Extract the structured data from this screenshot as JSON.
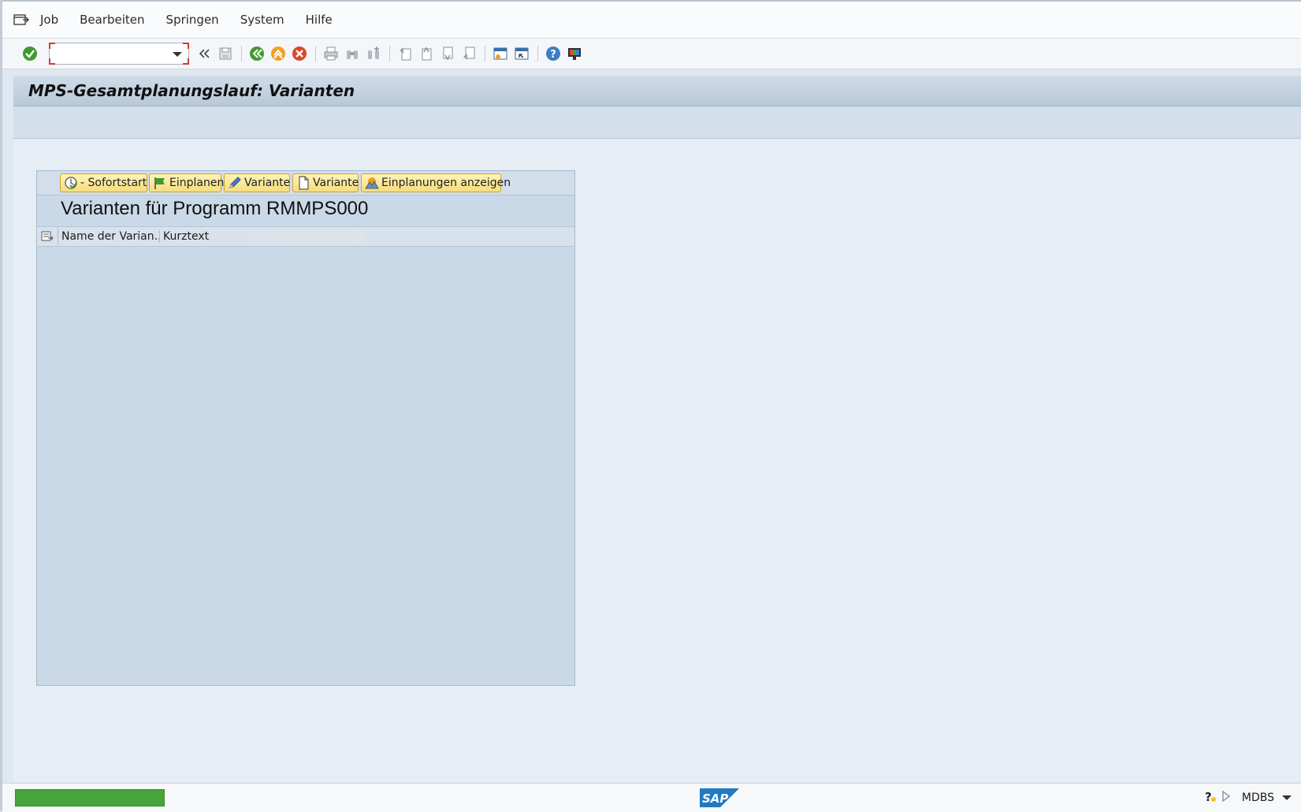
{
  "menubar": {
    "items": [
      "Job",
      "Bearbeiten",
      "Springen",
      "System",
      "Hilfe"
    ]
  },
  "toolbar": {
    "command_value": ""
  },
  "title": "MPS-Gesamtplanungslauf: Varianten",
  "panel": {
    "buttons": [
      {
        "label": "- Sofortstart",
        "icon": "execute-clock-icon"
      },
      {
        "label": "Einplanen",
        "icon": "flag-icon"
      },
      {
        "label": "Variante",
        "icon": "pencil-icon"
      },
      {
        "label": "Variante",
        "icon": "document-icon"
      },
      {
        "label": "Einplanungen anzeigen",
        "icon": "mountain-icon"
      }
    ],
    "title": "Varianten für Programm RMMPS000",
    "columns": [
      "Name der Varian...",
      "Kurztext"
    ]
  },
  "statusbar": {
    "progress": 1.0,
    "system": "MDBS",
    "logo": "SAP"
  },
  "colors": {
    "progress": "#48a43a",
    "button_bg": "#f6dd7d",
    "panel_bg": "#c9d9e8"
  }
}
